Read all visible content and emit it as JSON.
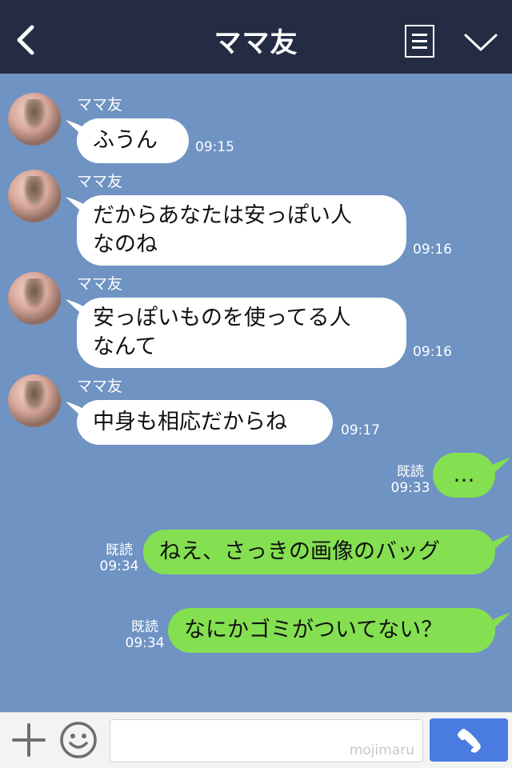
{
  "header": {
    "title": "ママ友",
    "back_icon": "chevron-left-icon",
    "menu_icon": "notes-icon",
    "collapse_icon": "chevron-down-icon"
  },
  "messages": [
    {
      "from": "ママ友",
      "text": "ふうん",
      "time": "09:15"
    },
    {
      "from": "ママ友",
      "line1": "だからあなたは安っぽい人",
      "line2": "なのね",
      "time": "09:16"
    },
    {
      "from": "ママ友",
      "line1": "安っぽいものを使ってる人",
      "line2": "なんて",
      "time": "09:16"
    },
    {
      "from": "ママ友",
      "text": "中身も相応だからね",
      "time": "09:17"
    },
    {
      "from": "me",
      "text": "…",
      "read": "既読",
      "time": "09:33"
    },
    {
      "from": "me",
      "text": "ねえ、さっきの画像のバッグ",
      "read": "既読",
      "time": "09:34"
    },
    {
      "from": "me",
      "text": "なにかゴミがついてない？",
      "read": "既読",
      "time": "09:34"
    }
  ],
  "input": {
    "plus_icon": "plus-icon",
    "emoji_icon": "smiley-icon",
    "watermark": "mojimaru",
    "call_icon": "phone-icon"
  },
  "colors": {
    "header_bg": "#232c43",
    "chat_bg": "#6f93c2",
    "incoming_bubble": "#ffffff",
    "outgoing_bubble": "#84e051",
    "call_button": "#4a7be0"
  }
}
